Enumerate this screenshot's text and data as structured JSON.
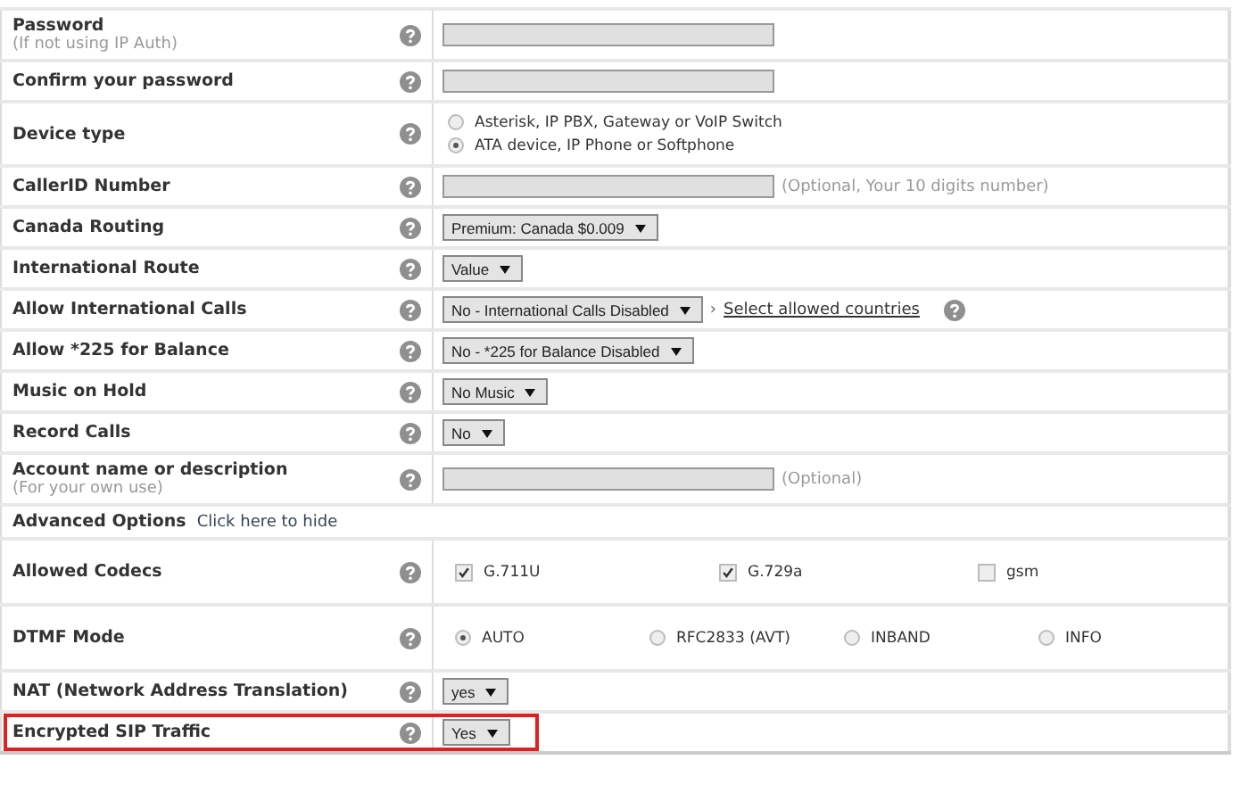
{
  "rows": [
    {
      "kind": "input",
      "label": "Password",
      "sublabel": "(If not using IP Auth)",
      "highlighted": false
    },
    {
      "kind": "input",
      "label": "Confirm your password",
      "highlighted": false
    },
    {
      "kind": "radio",
      "label": "Device type",
      "highlighted": false,
      "options": [
        {
          "label": "Asterisk, IP PBX, Gateway or VoIP Switch",
          "selected": false
        },
        {
          "label": "ATA device, IP Phone or Softphone",
          "selected": true
        }
      ]
    },
    {
      "kind": "input",
      "label": "CallerID Number",
      "note": "(Optional, Your 10 digits number)",
      "highlighted": false
    },
    {
      "kind": "select",
      "label": "Canada Routing",
      "value": "Premium: Canada $0.009",
      "highlighted": false
    },
    {
      "kind": "select",
      "label": "International Route",
      "value": "Value",
      "highlighted": false
    },
    {
      "kind": "select",
      "label": "Allow International Calls",
      "value": "No - International Calls Disabled",
      "link_marker": "›",
      "link": "Select allowed countries",
      "highlighted": false
    },
    {
      "kind": "select",
      "label": "Allow *225 for Balance",
      "value": "No - *225 for Balance Disabled",
      "highlighted": false
    },
    {
      "kind": "select",
      "label": "Music on Hold",
      "value": "No Music",
      "highlighted": false
    },
    {
      "kind": "select",
      "label": "Record Calls",
      "value": "No",
      "highlighted": false
    },
    {
      "kind": "input",
      "label": "Account name or description",
      "sublabel": "(For your own use)",
      "note": "(Optional)",
      "highlighted": false
    },
    {
      "kind": "section",
      "label": "Advanced Options",
      "link": "Click here to hide",
      "highlighted": false
    },
    {
      "kind": "checkboxes",
      "label": "Allowed Codecs",
      "highlighted": false,
      "options": [
        {
          "label": "G.711U",
          "checked": true
        },
        {
          "label": "G.729a",
          "checked": true
        },
        {
          "label": "gsm",
          "checked": false
        }
      ]
    },
    {
      "kind": "radio-row",
      "label": "DTMF Mode",
      "highlighted": false,
      "options": [
        {
          "label": "AUTO",
          "selected": true
        },
        {
          "label": "RFC2833 (AVT)",
          "selected": false
        },
        {
          "label": "INBAND",
          "selected": false
        },
        {
          "label": "INFO",
          "selected": false
        }
      ]
    },
    {
      "kind": "select",
      "label": "NAT (Network Address Translation)",
      "value": "yes",
      "highlighted": false
    },
    {
      "kind": "select",
      "label": "Encrypted SIP Traffic",
      "value": "Yes",
      "highlighted": true
    }
  ]
}
